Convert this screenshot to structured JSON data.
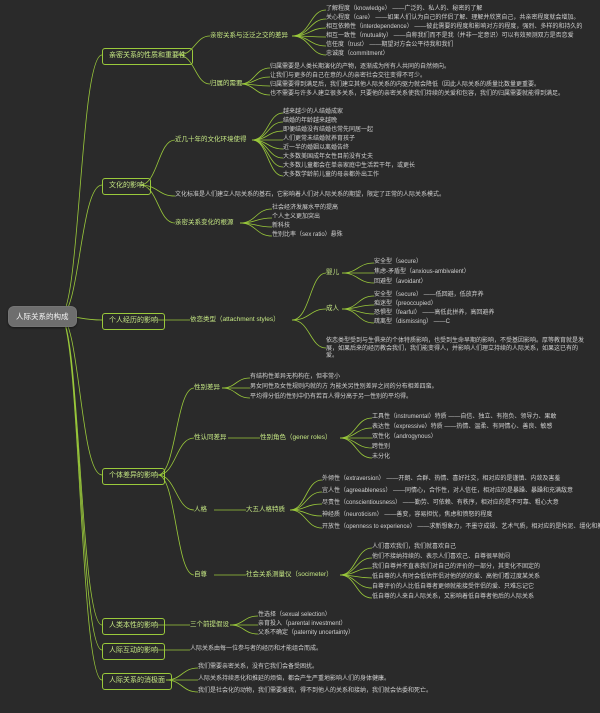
{
  "root": "人际关系的构成",
  "topics": {
    "t1": "亲密关系的性质和重要性",
    "t2": "文化的影响",
    "t3": "个人经历的影响",
    "t4": "个体差异的影响",
    "t5": "人类本性的影响",
    "t6": "人际互动的影响",
    "t7": "人际关系的消极面"
  },
  "keys": {
    "k1a": "亲密关系与泛泛之交的差异",
    "k1b": "归属的需要",
    "k2a": "近几十年的文化环境使得",
    "k2b": "文化标准是人们建立人际关系的基石，它影响着人们对人际关系的期望，限定了正常的人际关系模式。",
    "k2c": "亲密关系变化的根源",
    "k3a": "依恋类型（attachment styles）",
    "k4a": "性别差异",
    "k4b": "性认同差异",
    "k4c": "人格",
    "k4d": "自尊",
    "k5a": "三个前提假设",
    "k6a": "人际关系由每一位参与者的经历和才能组合而成。"
  },
  "subkeys": {
    "s1a1": "了解程度（knowledge） ——广泛的、私人的、秘密的了解",
    "s1a2": "关心程度（care） ——如果人们认为自己的伴侣了解、理解并欣赏自己，共亲密程度就会增加。",
    "s1a3": "相互依赖性（interdependence） ——彼此需要的程度和影响对方的程度，强烈、多样的和持久的",
    "s1a4": "相互一致性（mutuality） ——自称我们而不是我（并非一定意识）可以有效预测双方是否恋爱",
    "s1a5": "信任度（trust） ——期望对方会公平待我和我们",
    "s1a6": "忠诚度（commitment）",
    "s1b1": "归属需要是人类长期演化的产物，逐渐成为所有人共同的自然倾向。",
    "s1b2": "让我们与更多的自己在意的人的亲密社会交往变得不可少。",
    "s1b3": "归属需要得到满足后，我们建立其他人际关系的内驱力就会降低（因此人际关系的质量比数量更重要。",
    "s1b4": "也不需要与许多人建立很多关系，只要他的亲密关系使我们持续的关爱和包容，我们的归属需要就能得到满足。",
    "s2a1": "越来越少的人结婚成家",
    "s2a2": "结婚的年龄越来越晚",
    "s2a3": "即便结婚没有结婚也常先同居一起",
    "s2a4": "人们更常未结婚就养育孩子",
    "s2a5": "近一半的婚姻以离婚告终",
    "s2a6": "大多数美国成年女性目前没有丈夫",
    "s2a7": "大多数儿童都会在单亲家庭中生活若干年，或更长",
    "s2a8": "大多数学龄前儿童的母亲都外出工作",
    "s2c1": "社会经济发展水平的提高",
    "s2c2": "个人主义更加突出",
    "s2c3": "新科技",
    "s2c4": "性别比率（sex ratio）悬殊",
    "s3a_l": "婴儿",
    "s3a_r": "成人",
    "s3a_b1": "安全型（secure）",
    "s3a_b2": "焦虑-矛盾型（anxious-ambivalent）",
    "s3a_b3": "回避型（avoidant）",
    "s3a_a1": "安全型（secure） ——低回避，低放弃养",
    "s3a_a2": "痴迷型（preoccupied）",
    "s3a_a3": "恐惧型（fearful） ——高低此拼养，高回避养",
    "s3a_a4": "疏离型（dismissing） ——C",
    "s3a_f": "依恋类型受到与生俱来的个体特质影响，也受到生命早期的影响，不受基因影响。厚等教育就是发展，如果后来的经历教会我们，我们能变得人，并影响人们理立持续的人际关系，如果这已有的爱。",
    "s4a1": "有结构性差异无构构在，但非常小",
    "s4a2": "男女同性及女性规则内就的方   为能关另性别差异之间的分布相差四蛮。",
    "s4a3": "平均得分低的性别中仍有若百人得分高于另一性别的平均得。",
    "s4b_l": "性别角色（gener roles）",
    "s4b1": "工具性（instrumental）特质 ——自信、独立、有抱负、领导力、果敢",
    "s4b2": "表达性（expressive）特质 ——热情、温柔、有同情心、善良、敏感",
    "s4b3": "双性化（androgynous）",
    "s4b4": "跨性别",
    "s4b5": "未分化",
    "s4c_l": "大五人格特质",
    "s4c1": "外倾性（extraversion） ——开朗、合群、热情、喜好社交，相对应的是谨慎、内敛及害羞",
    "s4c2": "宜人性（agreeableness） ——同情心，合作性，对人信任，相对应的是暴躁、暴躁和充满敌意",
    "s4c3": "尽责性（conscientiousness） ——勤劳、可依赖、有秩序，相对应的是不可靠、粗心大意",
    "s4c4": "神经质（neuroticism） ——善变，容易担忧，焦虑和愤怒的程度",
    "s4c5": "开放性（openness to experience） ——求新想象力，不墨守成规、艺术气质，相对应的是拘泥、缰化和教条",
    "s4d_l": "社会关系测量仪（socimeter）",
    "s4d1": "人们喜欢我们，我们就喜欢自己",
    "s4d2": "他们不接纳持续的、表示人们喜欢己、自尊很早就闷",
    "s4d3": "我们自尊并不直表我们对自己的评价的一部分，其变化不固定的",
    "s4d4": "低自尊的人有时会低估伴侣对他的的的爱、高他们看过度某关系",
    "s4d5": "自尊评价的人比低自尊者更倾就能接受伴侣的爱、只难忘记它",
    "s4d6": "低自尊的人来自人际关系，又影响着低自尊者他后的人际关系",
    "s5a1": "性选择（sexual selection）",
    "s5a2": "亲育投入（parental investment）",
    "s5a3": "父系不确定（paternity uncertainty）",
    "s7a": "我们需要亲密关系，没有它我们会备受困扰。",
    "s7b": "人际关系持续恶化和推延的烦恼，都会产生严重地影响人们的身体健康。",
    "s7c": "我们是社会化的动物，我们需要爱我，得不到他人的关系和接纳，我们就会估委和死亡。"
  }
}
